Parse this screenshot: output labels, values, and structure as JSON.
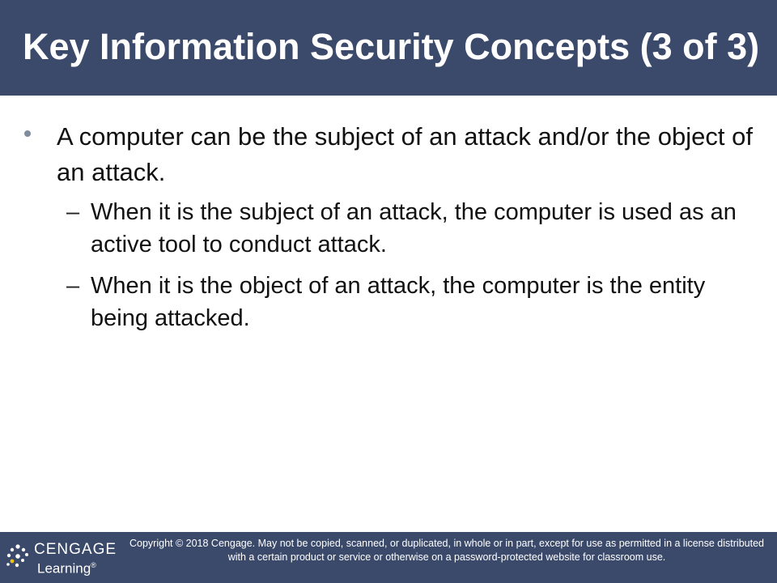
{
  "slide": {
    "title": "Key Information Security Concepts (3 of 3)",
    "bullets": [
      {
        "text": "A computer can be the subject of an attack and/or the object of an attack.",
        "sub": [
          {
            "marker": "–",
            "text": "When it is the subject of an attack, the computer is used as an active tool to conduct attack."
          },
          {
            "marker": "–",
            "text": "When it is the object of an attack, the computer is the entity being attacked."
          }
        ]
      }
    ]
  },
  "footer": {
    "logo_line1": "CENGAGE",
    "logo_line2": "Learning",
    "logo_mark": "®",
    "copyright": "Copyright © 2018 Cengage. May not be copied, scanned, or duplicated, in whole or in part, except for use as permitted in a license distributed with a certain product or service or otherwise on a password-protected website for classroom use."
  },
  "colors": {
    "title_bar": "#3b4a6b",
    "footer_bar": "#3b4a6b",
    "body_text": "#111111"
  }
}
